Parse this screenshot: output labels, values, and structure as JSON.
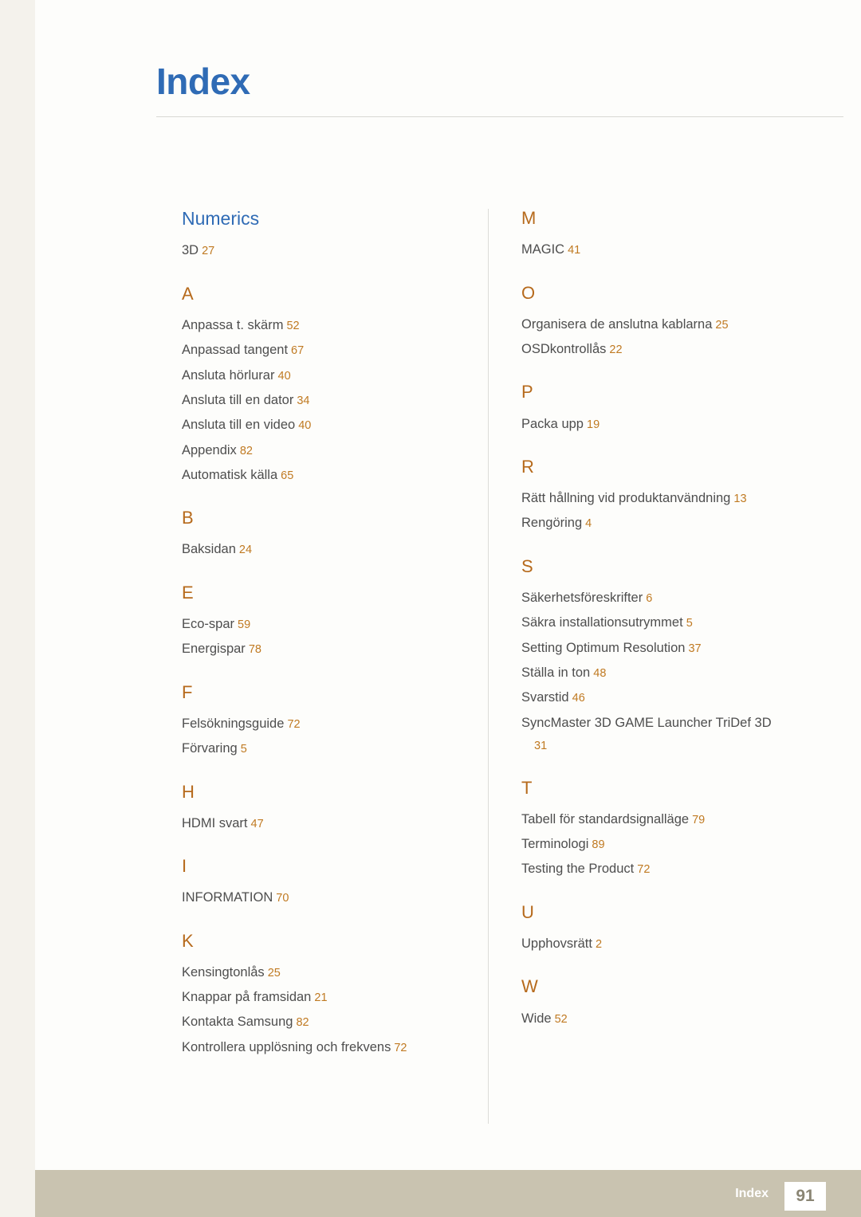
{
  "page": {
    "title": "Index",
    "footer_label": "Index",
    "footer_page": "91"
  },
  "colors": {
    "title_blue": "#2f6bb5",
    "section_orange": "#b66a1c",
    "page_number_orange": "#c07a22",
    "entry_gray": "#4e4e4e",
    "footer_band": "#c9c3b0"
  },
  "columns": [
    {
      "sections": [
        {
          "heading": "Numerics",
          "style": "numerics",
          "entries": [
            {
              "text": "3D",
              "page": "27"
            }
          ]
        },
        {
          "heading": "A",
          "entries": [
            {
              "text": "Anpassa t. skärm",
              "page": "52"
            },
            {
              "text": "Anpassad tangent",
              "page": "67"
            },
            {
              "text": "Ansluta hörlurar",
              "page": "40"
            },
            {
              "text": "Ansluta till en dator",
              "page": "34"
            },
            {
              "text": "Ansluta till en video",
              "page": "40"
            },
            {
              "text": "Appendix",
              "page": "82"
            },
            {
              "text": "Automatisk källa",
              "page": "65"
            }
          ]
        },
        {
          "heading": "B",
          "entries": [
            {
              "text": "Baksidan",
              "page": "24"
            }
          ]
        },
        {
          "heading": "E",
          "entries": [
            {
              "text": "Eco-spar",
              "page": "59"
            },
            {
              "text": "Energispar",
              "page": "78"
            }
          ]
        },
        {
          "heading": "F",
          "entries": [
            {
              "text": "Felsökningsguide",
              "page": "72"
            },
            {
              "text": "Förvaring",
              "page": "5"
            }
          ]
        },
        {
          "heading": "H",
          "entries": [
            {
              "text": "HDMI svart",
              "page": "47"
            }
          ]
        },
        {
          "heading": "I",
          "entries": [
            {
              "text": "INFORMATION",
              "page": "70"
            }
          ]
        },
        {
          "heading": "K",
          "entries": [
            {
              "text": "Kensingtonlås",
              "page": "25"
            },
            {
              "text": "Knappar på framsidan",
              "page": "21"
            },
            {
              "text": "Kontakta Samsung",
              "page": "82"
            },
            {
              "text": "Kontrollera upplösning och frekvens",
              "page": "72"
            }
          ]
        }
      ]
    },
    {
      "sections": [
        {
          "heading": "M",
          "entries": [
            {
              "text": "MAGIC",
              "page": "41"
            }
          ]
        },
        {
          "heading": "O",
          "entries": [
            {
              "text": "Organisera de anslutna kablarna",
              "page": "25"
            },
            {
              "text": "OSDkontrollås",
              "page": "22"
            }
          ]
        },
        {
          "heading": "P",
          "entries": [
            {
              "text": "Packa upp",
              "page": "19"
            }
          ]
        },
        {
          "heading": "R",
          "entries": [
            {
              "text": "Rätt hållning vid produktanvändning",
              "page": "13"
            },
            {
              "text": "Rengöring",
              "page": "4"
            }
          ]
        },
        {
          "heading": "S",
          "entries": [
            {
              "text": "Säkerhetsföreskrifter",
              "page": "6"
            },
            {
              "text": "Säkra installationsutrymmet",
              "page": "5"
            },
            {
              "text": "Setting Optimum Resolution",
              "page": "37"
            },
            {
              "text": "Ställa in ton",
              "page": "48"
            },
            {
              "text": "Svarstid",
              "page": "46"
            },
            {
              "text": "SyncMaster 3D GAME Launcher TriDef 3D",
              "page": "31",
              "wrap": true
            }
          ]
        },
        {
          "heading": "T",
          "entries": [
            {
              "text": "Tabell för standardsignalläge",
              "page": "79"
            },
            {
              "text": "Terminologi",
              "page": "89"
            },
            {
              "text": "Testing the Product",
              "page": "72"
            }
          ]
        },
        {
          "heading": "U",
          "entries": [
            {
              "text": "Upphovsrätt",
              "page": "2"
            }
          ]
        },
        {
          "heading": "W",
          "entries": [
            {
              "text": "Wide",
              "page": "52"
            }
          ]
        }
      ]
    }
  ]
}
